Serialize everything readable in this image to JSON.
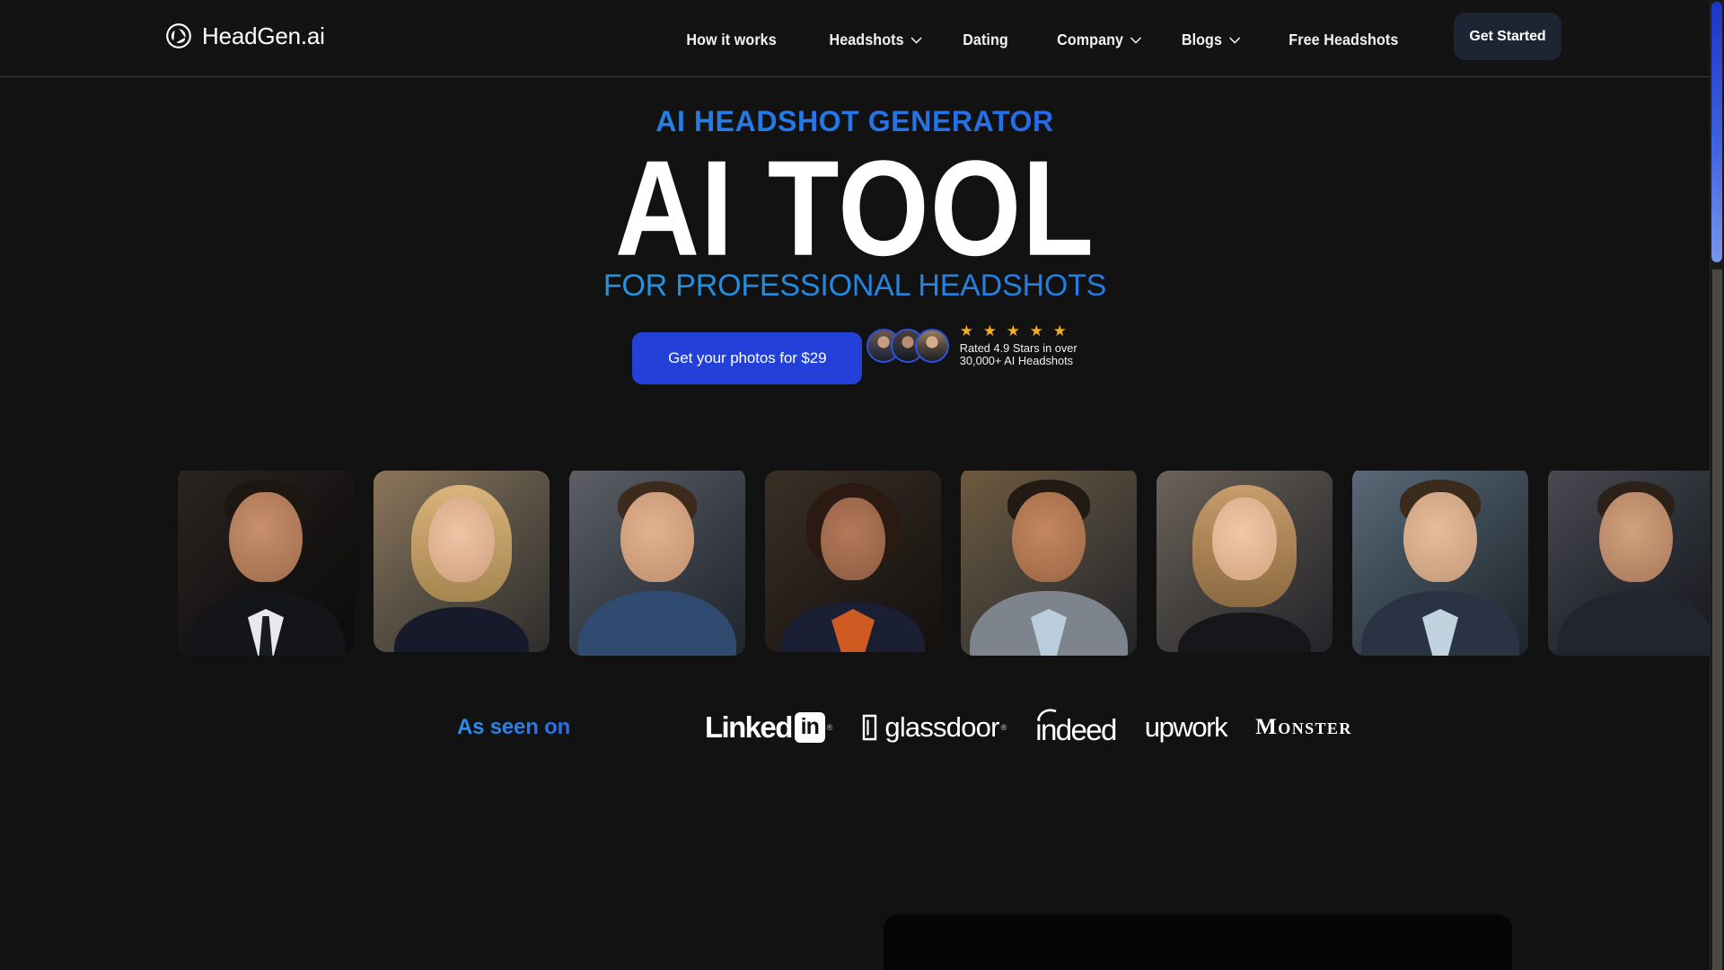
{
  "brand": {
    "name": "HeadGen.ai",
    "logo_icon": "camera-shutter-icon"
  },
  "nav": {
    "items": [
      {
        "label": "How it works",
        "has_dropdown": false
      },
      {
        "label": "Headshots",
        "has_dropdown": true
      },
      {
        "label": "Dating",
        "has_dropdown": false
      },
      {
        "label": "Company",
        "has_dropdown": true
      },
      {
        "label": "Blogs",
        "has_dropdown": true
      },
      {
        "label": "Free Headshots",
        "has_dropdown": false
      }
    ],
    "cta_label": "Get Started"
  },
  "hero": {
    "eyebrow": "AI HEADSHOT GENERATOR",
    "headline": "AI TOOL",
    "subheadline": "FOR PROFESSIONAL HEADSHOTS",
    "cta_label": "Get your photos for $29",
    "accent_gradient_start": "#1f9fe8",
    "accent_gradient_end": "#2a45df",
    "cta_color": "#2340d8"
  },
  "rating": {
    "stars_glyphs": "★ ★ ★ ★ ★",
    "star_count": 5,
    "star_color": "#f2ad20",
    "line1": "Rated 4.9 Stars in over",
    "line2": "30,000+ AI Headshots",
    "avatars": [
      {
        "name": "avatar-woman-1"
      },
      {
        "name": "avatar-man-1"
      },
      {
        "name": "avatar-woman-2"
      }
    ]
  },
  "gallery": {
    "items": [
      {
        "alt": "headshot-man-dark-suit"
      },
      {
        "alt": "headshot-woman-blonde"
      },
      {
        "alt": "headshot-man-blue-shirt"
      },
      {
        "alt": "headshot-woman-orange-top"
      },
      {
        "alt": "headshot-man-grey-suit"
      },
      {
        "alt": "headshot-woman-long-hair"
      },
      {
        "alt": "headshot-man-navy-suit"
      },
      {
        "alt": "headshot-partial"
      }
    ]
  },
  "as_seen_on": {
    "label": "As seen on",
    "label_color": "#2f8fe8",
    "logos": [
      {
        "name": "linkedin-logo",
        "word": "Linked",
        "badge": "in",
        "mark": "®"
      },
      {
        "name": "glassdoor-logo",
        "word": "glassdoor",
        "mark": "®"
      },
      {
        "name": "indeed-logo",
        "word": "indeed"
      },
      {
        "name": "upwork-logo",
        "word": "upwork"
      },
      {
        "name": "monster-logo",
        "word": "Monster"
      }
    ]
  },
  "scrollbar": {
    "thumb_gradient_start": "#1b36c4",
    "thumb_gradient_end": "#7b95ea"
  }
}
